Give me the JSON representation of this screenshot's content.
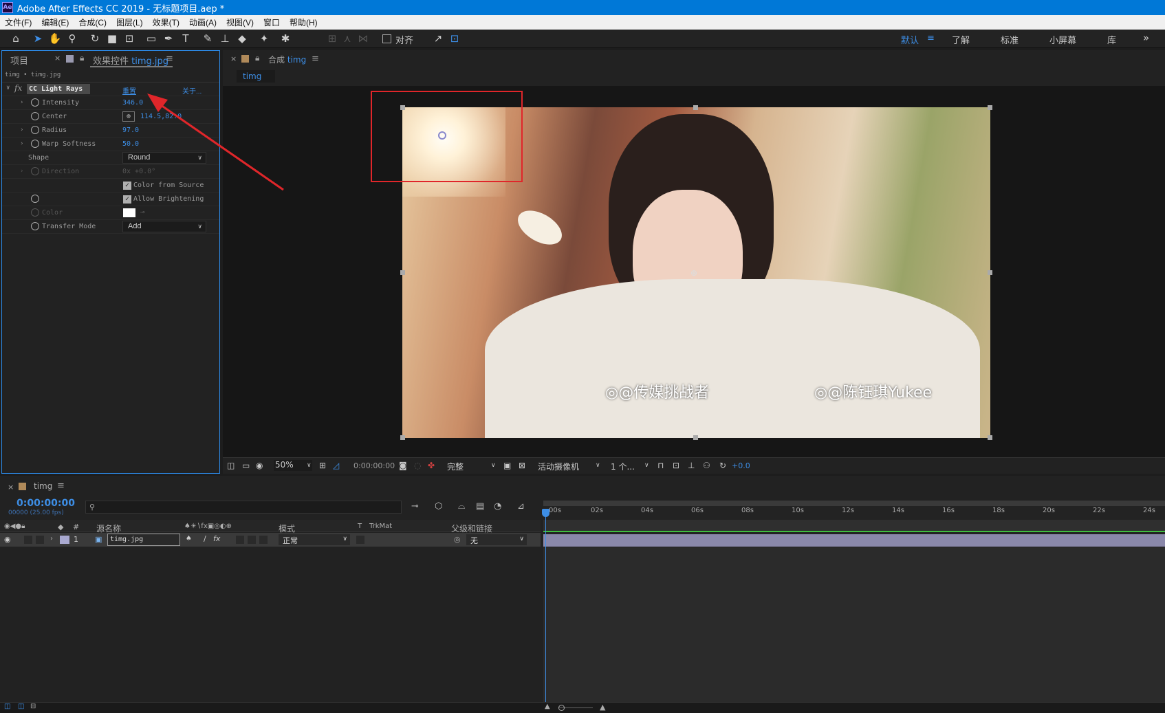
{
  "window": {
    "title": "Adobe After Effects CC 2019 - 无标题项目.aep *",
    "logo": "Ae"
  },
  "menu": [
    "文件(F)",
    "编辑(E)",
    "合成(C)",
    "图层(L)",
    "效果(T)",
    "动画(A)",
    "视图(V)",
    "窗口",
    "帮助(H)"
  ],
  "toolbar": {
    "align_label": "对齐",
    "workspaces": [
      "默认",
      "了解",
      "标准",
      "小屏幕",
      "库"
    ],
    "more": "»"
  },
  "left_panel": {
    "tab_project": "项目",
    "tab_effects_prefix": "效果控件",
    "tab_effects_layer": "timg.jpg",
    "breadcrumb": "timg • timg.jpg",
    "effect_name": "CC Light Rays",
    "reset": "重置",
    "about": "关于...",
    "props": {
      "intensity_label": "Intensity",
      "intensity_value": "346.0",
      "center_label": "Center",
      "center_value": "114.5,82.0",
      "radius_label": "Radius",
      "radius_value": "97.0",
      "warp_label": "Warp Softness",
      "warp_value": "50.0",
      "shape_label": "Shape",
      "shape_value": "Round",
      "direction_label": "Direction",
      "direction_value": "0x +0.0°",
      "color_from_source": "Color from Source",
      "allow_brightening": "Allow Brightening",
      "color_label": "Color",
      "transfer_label": "Transfer Mode",
      "transfer_value": "Add"
    }
  },
  "comp_panel": {
    "tab_prefix": "合成",
    "tab_name": "timg",
    "subtab": "timg",
    "watermark1": "@传媒挑战者",
    "watermark2": "@陈钰琪Yukee"
  },
  "viewer_bar": {
    "zoom": "50%",
    "timecode": "0:00:00:00",
    "resolution": "完整",
    "camera": "活动摄像机",
    "views": "1 个...",
    "exposure": "+0.0"
  },
  "timeline": {
    "tab_name": "timg",
    "timecode": "0:00:00:00",
    "frames": "00000 (25.00 fps)",
    "col_num": "#",
    "col_source": "源名称",
    "col_mode": "模式",
    "col_t": "T",
    "col_trkmat": "TrkMat",
    "col_parent": "父级和链接",
    "layer": {
      "num": "1",
      "name": "timg.jpg",
      "mode": "正常",
      "parent": "无"
    },
    "ticks": [
      "00s",
      "02s",
      "04s",
      "06s",
      "08s",
      "10s",
      "12s",
      "14s",
      "16s",
      "18s",
      "20s",
      "22s",
      "24s"
    ]
  },
  "colors": {
    "accent": "#2d8ceb",
    "highlight_box": "#e0262a",
    "arrow": "#e0262a",
    "titlebar": "#0078d7"
  }
}
